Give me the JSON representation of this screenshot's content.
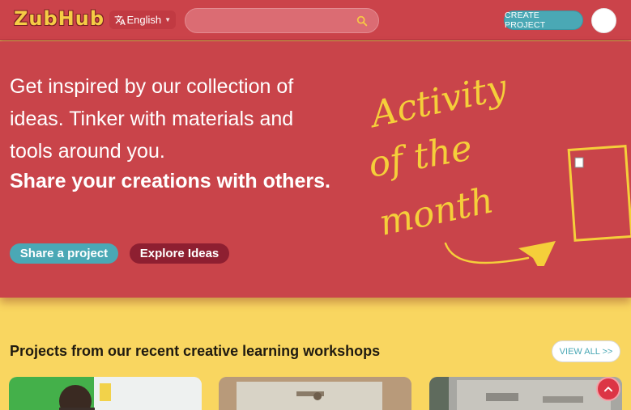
{
  "header": {
    "logo_text": "ZubHub",
    "language": "English",
    "search_placeholder": "",
    "create_project_label": "CREATE PROJECT"
  },
  "hero": {
    "intro_text": "Get inspired by our collection of ideas. Tinker with materials and tools around you.",
    "bold_text": "Share your creations with others.",
    "share_button_label": "Share a project",
    "explore_button_label": "Explore Ideas",
    "activity_line1": "Activity",
    "activity_line2": "of the",
    "activity_line3": "month"
  },
  "projects": {
    "section_title": "Projects from our recent creative learning workshops",
    "view_all_label": "VIEW ALL >>"
  },
  "colors": {
    "header_bg": "#cb434a",
    "hero_bg": "#c9444a",
    "page_bg": "#f9d660",
    "accent_teal": "#4aa8b5",
    "accent_maroon": "#8e1f31",
    "activity_yellow": "#f5cf3a"
  },
  "icons": {
    "translate": "translate-icon",
    "language_caret": "caret-down-icon",
    "search": "search-icon",
    "scroll_top": "chevron-up-icon"
  }
}
